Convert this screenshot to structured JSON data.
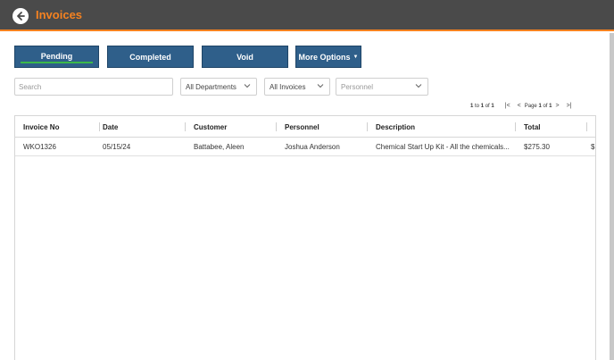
{
  "header": {
    "title": "Invoices"
  },
  "tabs": [
    {
      "label": "Pending"
    },
    {
      "label": "Completed"
    },
    {
      "label": "Void"
    },
    {
      "label": "More Options"
    }
  ],
  "filters": {
    "search_placeholder": "Search",
    "departments": "All Departments",
    "invoices": "All Invoices",
    "personnel": "Personnel"
  },
  "pager": {
    "range_from": "1",
    "range_to_label": "to",
    "range_to": "1",
    "of_label": "of",
    "total": "1",
    "page_label": "Page",
    "page": "1",
    "page_of_label": "of",
    "page_count": "1"
  },
  "table": {
    "columns": [
      "Invoice No",
      "Date",
      "Customer",
      "Personnel",
      "Description",
      "Total"
    ],
    "rows": [
      {
        "invoice_no": "WKO1326",
        "date": "05/15/24",
        "customer": "Battabee, Aleen",
        "personnel": "Joshua Anderson",
        "description": "Chemical Start Up Kit - All the chemicals...",
        "total": "$275.30",
        "overflow": "$"
      }
    ]
  },
  "colors": {
    "header_bg": "#4a4a4a",
    "accent": "#f58220",
    "tab_bg": "#2f5f8a",
    "active_line": "#3cb84a"
  }
}
